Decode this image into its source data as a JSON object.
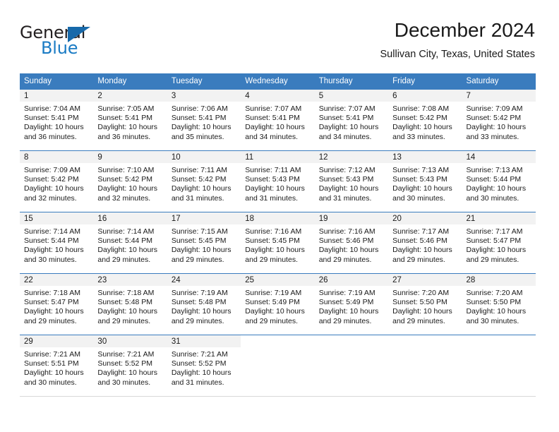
{
  "logo": {
    "word_one": "General",
    "word_two": "Blue",
    "triangle_icon": "triangle-icon"
  },
  "header": {
    "title": "December 2024",
    "subtitle": "Sullivan City, Texas, United States"
  },
  "colors": {
    "header_blue": "#3a7cbe",
    "logo_blue": "#1a7bc4",
    "day_band_gray": "#f2f2f2",
    "text": "#1a1a1a"
  },
  "weekday_headers": [
    "Sunday",
    "Monday",
    "Tuesday",
    "Wednesday",
    "Thursday",
    "Friday",
    "Saturday"
  ],
  "weeks": [
    [
      {
        "day": "1",
        "sunrise": "Sunrise: 7:04 AM",
        "sunset": "Sunset: 5:41 PM",
        "daylight_1": "Daylight: 10 hours",
        "daylight_2": "and 36 minutes."
      },
      {
        "day": "2",
        "sunrise": "Sunrise: 7:05 AM",
        "sunset": "Sunset: 5:41 PM",
        "daylight_1": "Daylight: 10 hours",
        "daylight_2": "and 36 minutes."
      },
      {
        "day": "3",
        "sunrise": "Sunrise: 7:06 AM",
        "sunset": "Sunset: 5:41 PM",
        "daylight_1": "Daylight: 10 hours",
        "daylight_2": "and 35 minutes."
      },
      {
        "day": "4",
        "sunrise": "Sunrise: 7:07 AM",
        "sunset": "Sunset: 5:41 PM",
        "daylight_1": "Daylight: 10 hours",
        "daylight_2": "and 34 minutes."
      },
      {
        "day": "5",
        "sunrise": "Sunrise: 7:07 AM",
        "sunset": "Sunset: 5:41 PM",
        "daylight_1": "Daylight: 10 hours",
        "daylight_2": "and 34 minutes."
      },
      {
        "day": "6",
        "sunrise": "Sunrise: 7:08 AM",
        "sunset": "Sunset: 5:42 PM",
        "daylight_1": "Daylight: 10 hours",
        "daylight_2": "and 33 minutes."
      },
      {
        "day": "7",
        "sunrise": "Sunrise: 7:09 AM",
        "sunset": "Sunset: 5:42 PM",
        "daylight_1": "Daylight: 10 hours",
        "daylight_2": "and 33 minutes."
      }
    ],
    [
      {
        "day": "8",
        "sunrise": "Sunrise: 7:09 AM",
        "sunset": "Sunset: 5:42 PM",
        "daylight_1": "Daylight: 10 hours",
        "daylight_2": "and 32 minutes."
      },
      {
        "day": "9",
        "sunrise": "Sunrise: 7:10 AM",
        "sunset": "Sunset: 5:42 PM",
        "daylight_1": "Daylight: 10 hours",
        "daylight_2": "and 32 minutes."
      },
      {
        "day": "10",
        "sunrise": "Sunrise: 7:11 AM",
        "sunset": "Sunset: 5:42 PM",
        "daylight_1": "Daylight: 10 hours",
        "daylight_2": "and 31 minutes."
      },
      {
        "day": "11",
        "sunrise": "Sunrise: 7:11 AM",
        "sunset": "Sunset: 5:43 PM",
        "daylight_1": "Daylight: 10 hours",
        "daylight_2": "and 31 minutes."
      },
      {
        "day": "12",
        "sunrise": "Sunrise: 7:12 AM",
        "sunset": "Sunset: 5:43 PM",
        "daylight_1": "Daylight: 10 hours",
        "daylight_2": "and 31 minutes."
      },
      {
        "day": "13",
        "sunrise": "Sunrise: 7:13 AM",
        "sunset": "Sunset: 5:43 PM",
        "daylight_1": "Daylight: 10 hours",
        "daylight_2": "and 30 minutes."
      },
      {
        "day": "14",
        "sunrise": "Sunrise: 7:13 AM",
        "sunset": "Sunset: 5:44 PM",
        "daylight_1": "Daylight: 10 hours",
        "daylight_2": "and 30 minutes."
      }
    ],
    [
      {
        "day": "15",
        "sunrise": "Sunrise: 7:14 AM",
        "sunset": "Sunset: 5:44 PM",
        "daylight_1": "Daylight: 10 hours",
        "daylight_2": "and 30 minutes."
      },
      {
        "day": "16",
        "sunrise": "Sunrise: 7:14 AM",
        "sunset": "Sunset: 5:44 PM",
        "daylight_1": "Daylight: 10 hours",
        "daylight_2": "and 29 minutes."
      },
      {
        "day": "17",
        "sunrise": "Sunrise: 7:15 AM",
        "sunset": "Sunset: 5:45 PM",
        "daylight_1": "Daylight: 10 hours",
        "daylight_2": "and 29 minutes."
      },
      {
        "day": "18",
        "sunrise": "Sunrise: 7:16 AM",
        "sunset": "Sunset: 5:45 PM",
        "daylight_1": "Daylight: 10 hours",
        "daylight_2": "and 29 minutes."
      },
      {
        "day": "19",
        "sunrise": "Sunrise: 7:16 AM",
        "sunset": "Sunset: 5:46 PM",
        "daylight_1": "Daylight: 10 hours",
        "daylight_2": "and 29 minutes."
      },
      {
        "day": "20",
        "sunrise": "Sunrise: 7:17 AM",
        "sunset": "Sunset: 5:46 PM",
        "daylight_1": "Daylight: 10 hours",
        "daylight_2": "and 29 minutes."
      },
      {
        "day": "21",
        "sunrise": "Sunrise: 7:17 AM",
        "sunset": "Sunset: 5:47 PM",
        "daylight_1": "Daylight: 10 hours",
        "daylight_2": "and 29 minutes."
      }
    ],
    [
      {
        "day": "22",
        "sunrise": "Sunrise: 7:18 AM",
        "sunset": "Sunset: 5:47 PM",
        "daylight_1": "Daylight: 10 hours",
        "daylight_2": "and 29 minutes."
      },
      {
        "day": "23",
        "sunrise": "Sunrise: 7:18 AM",
        "sunset": "Sunset: 5:48 PM",
        "daylight_1": "Daylight: 10 hours",
        "daylight_2": "and 29 minutes."
      },
      {
        "day": "24",
        "sunrise": "Sunrise: 7:19 AM",
        "sunset": "Sunset: 5:48 PM",
        "daylight_1": "Daylight: 10 hours",
        "daylight_2": "and 29 minutes."
      },
      {
        "day": "25",
        "sunrise": "Sunrise: 7:19 AM",
        "sunset": "Sunset: 5:49 PM",
        "daylight_1": "Daylight: 10 hours",
        "daylight_2": "and 29 minutes."
      },
      {
        "day": "26",
        "sunrise": "Sunrise: 7:19 AM",
        "sunset": "Sunset: 5:49 PM",
        "daylight_1": "Daylight: 10 hours",
        "daylight_2": "and 29 minutes."
      },
      {
        "day": "27",
        "sunrise": "Sunrise: 7:20 AM",
        "sunset": "Sunset: 5:50 PM",
        "daylight_1": "Daylight: 10 hours",
        "daylight_2": "and 29 minutes."
      },
      {
        "day": "28",
        "sunrise": "Sunrise: 7:20 AM",
        "sunset": "Sunset: 5:50 PM",
        "daylight_1": "Daylight: 10 hours",
        "daylight_2": "and 30 minutes."
      }
    ],
    [
      {
        "day": "29",
        "sunrise": "Sunrise: 7:21 AM",
        "sunset": "Sunset: 5:51 PM",
        "daylight_1": "Daylight: 10 hours",
        "daylight_2": "and 30 minutes."
      },
      {
        "day": "30",
        "sunrise": "Sunrise: 7:21 AM",
        "sunset": "Sunset: 5:52 PM",
        "daylight_1": "Daylight: 10 hours",
        "daylight_2": "and 30 minutes."
      },
      {
        "day": "31",
        "sunrise": "Sunrise: 7:21 AM",
        "sunset": "Sunset: 5:52 PM",
        "daylight_1": "Daylight: 10 hours",
        "daylight_2": "and 31 minutes."
      },
      {
        "day": "",
        "sunrise": "",
        "sunset": "",
        "daylight_1": "",
        "daylight_2": ""
      },
      {
        "day": "",
        "sunrise": "",
        "sunset": "",
        "daylight_1": "",
        "daylight_2": ""
      },
      {
        "day": "",
        "sunrise": "",
        "sunset": "",
        "daylight_1": "",
        "daylight_2": ""
      },
      {
        "day": "",
        "sunrise": "",
        "sunset": "",
        "daylight_1": "",
        "daylight_2": ""
      }
    ]
  ]
}
